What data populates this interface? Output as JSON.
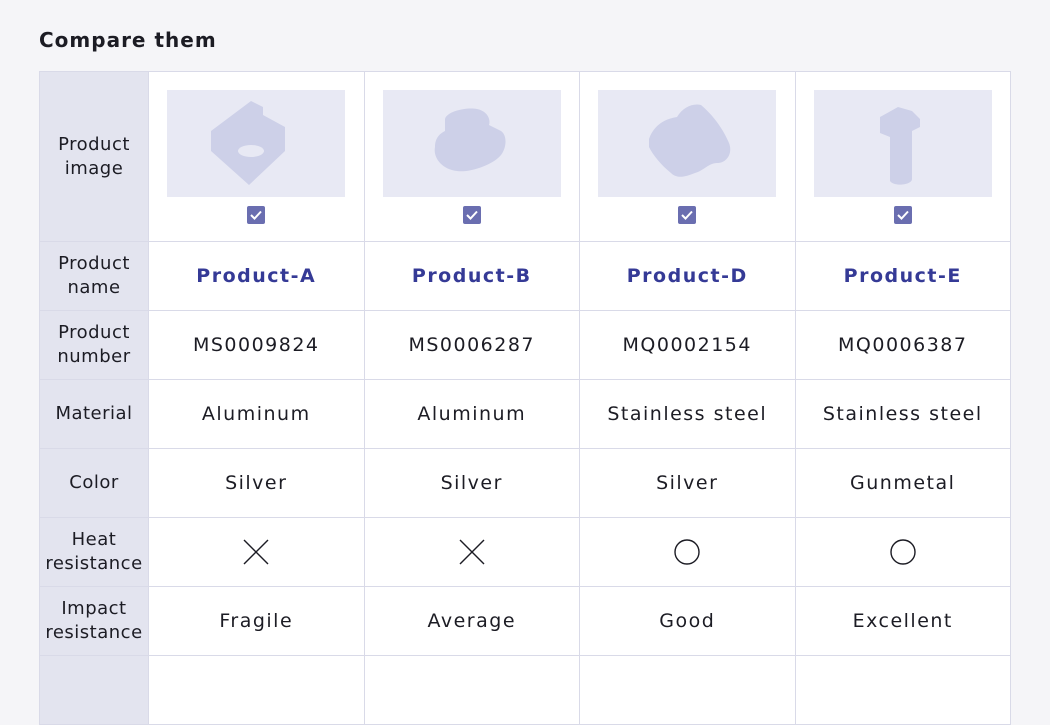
{
  "heading": "Compare them",
  "row_labels": {
    "image": [
      "Product",
      "image"
    ],
    "name": [
      "Product",
      "name"
    ],
    "number": [
      "Product",
      "number"
    ],
    "material": "Material",
    "color": "Color",
    "heat": [
      "Heat",
      "resistance"
    ],
    "impact": [
      "Impact",
      "resistance"
    ]
  },
  "products": [
    {
      "name": "Product-A",
      "number": "MS0009824",
      "material": "Aluminum",
      "color": "Silver",
      "heat": "cross",
      "impact": "Fragile",
      "selected": true,
      "image_icon": "angle-bracket-part-icon"
    },
    {
      "name": "Product-B",
      "number": "MS0006287",
      "material": "Aluminum",
      "color": "Silver",
      "heat": "cross",
      "impact": "Average",
      "selected": true,
      "image_icon": "stepped-block-part-icon"
    },
    {
      "name": "Product-D",
      "number": "MQ0002154",
      "material": "Stainless steel",
      "color": "Silver",
      "heat": "circle",
      "impact": "Good",
      "selected": true,
      "image_icon": "rounded-plate-part-icon"
    },
    {
      "name": "Product-E",
      "number": "MQ0006387",
      "material": "Stainless steel",
      "color": "Gunmetal",
      "heat": "circle",
      "impact": "Excellent",
      "selected": true,
      "image_icon": "flanged-pin-part-icon"
    }
  ],
  "colors": {
    "accent": "#353a96",
    "checkbox": "#6a6eb0",
    "header_bg": "#e3e4ef",
    "thumb_bg": "#e8e9f4",
    "part_fill": "#cdd0e8"
  }
}
